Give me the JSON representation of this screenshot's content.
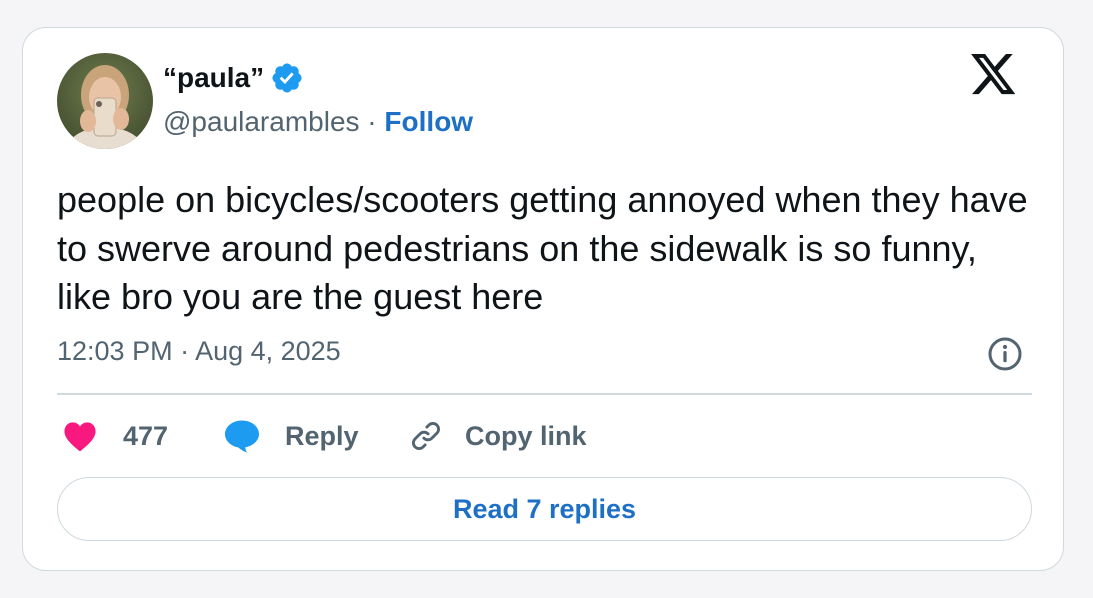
{
  "author": {
    "display_name": "“paula”",
    "handle": "@paularambles",
    "separator": " · ",
    "follow_label": "Follow",
    "verified": true
  },
  "brand_icon": "x-logo-icon",
  "tweet": {
    "text": "people on bicycles/scooters getting annoyed when they have to swerve around pedestrians on the sidewalk is so funny, like bro you are the guest here",
    "timestamp": "12:03 PM · Aug 4, 2025"
  },
  "actions": {
    "like_count": "477",
    "reply_label": "Reply",
    "copy_link_label": "Copy link"
  },
  "read_replies_label": "Read 7 replies",
  "colors": {
    "link_blue": "#1d70c6",
    "verified_blue": "#1d9bf0",
    "like_pink": "#f91880",
    "reply_blue": "#1d9bf0",
    "text_primary": "#0f1419",
    "text_secondary": "#536471",
    "border": "#cfd9de"
  }
}
